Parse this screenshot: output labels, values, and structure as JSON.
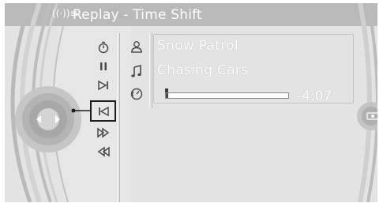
{
  "header": {
    "title": "Replay - Time Shift",
    "radio_icon": "radio-wave-icon"
  },
  "controls": [
    {
      "name": "timer-icon",
      "glyph": "⏱"
    },
    {
      "name": "pause-icon",
      "glyph": "❚❚"
    },
    {
      "name": "skip-next-icon",
      "glyph": "▷|"
    },
    {
      "name": "rewind-icon",
      "glyph": "◁",
      "selected": true
    },
    {
      "name": "fast-forward-icon",
      "glyph": "⊳⊳"
    },
    {
      "name": "fast-rewind-icon",
      "glyph": "⊲⊲"
    }
  ],
  "now_playing": {
    "artist": "Snow Patrol",
    "title": "Chasing Cars",
    "remaining": "-4:07",
    "progress_fraction": 0.02
  },
  "colors": {
    "background": "#e3e3e3",
    "header": "#b9b9b9",
    "text": "#ffffff",
    "icon": "#4a4a4a"
  }
}
